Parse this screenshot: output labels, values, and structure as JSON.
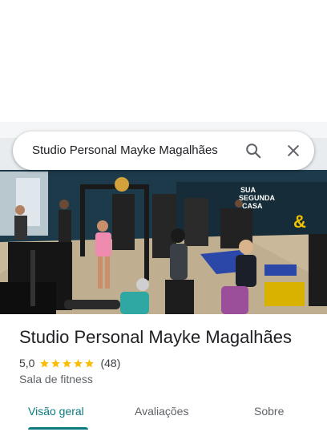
{
  "search": {
    "query": "Studio Personal Mayke Magalhães",
    "search_icon": "search-icon",
    "close_icon": "close-icon"
  },
  "photo": {
    "wall_text_line1": "SUA",
    "wall_text_line2": "SEGUNDA",
    "wall_text_line3": "CASA"
  },
  "place": {
    "name": "Studio Personal Mayke Magalhães",
    "rating": "5,0",
    "stars": 5,
    "review_count": "(48)",
    "category": "Sala de fitness"
  },
  "tabs": [
    {
      "label": "Visão geral",
      "active": true
    },
    {
      "label": "Avaliações",
      "active": false
    },
    {
      "label": "Sobre",
      "active": false
    }
  ],
  "colors": {
    "accent": "#0b7a80",
    "star": "#fbbc04"
  }
}
